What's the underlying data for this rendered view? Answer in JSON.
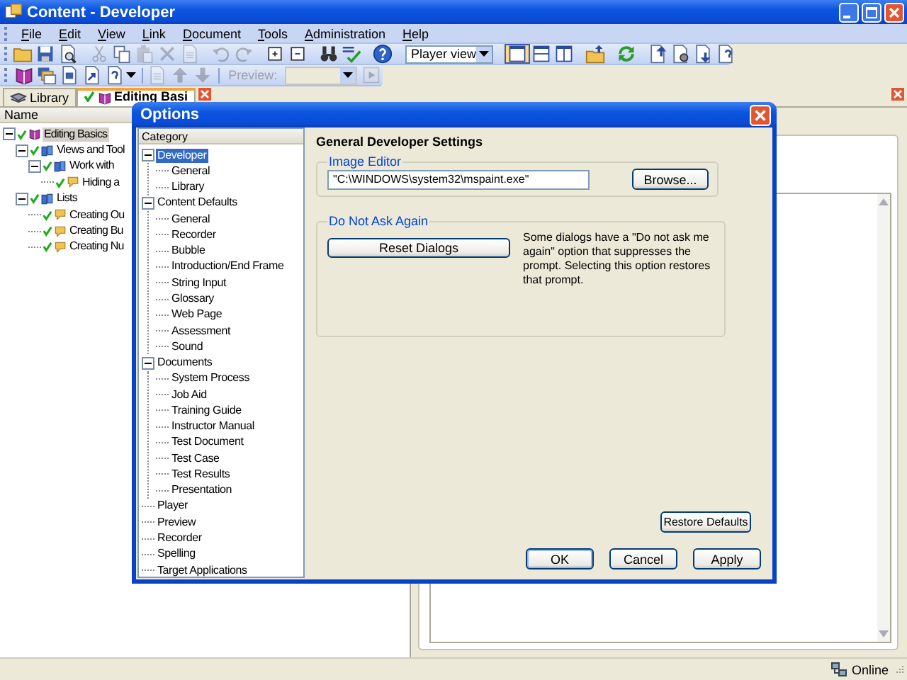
{
  "window": {
    "title": "Content - Developer"
  },
  "menu": [
    "File",
    "Edit",
    "View",
    "Link",
    "Document",
    "Tools",
    "Administration",
    "Help"
  ],
  "toolbar_1": [
    {
      "kind": "button",
      "disabled": false,
      "selected": false
    },
    {
      "kind": "button",
      "disabled": false,
      "selected": false
    },
    {
      "kind": "button",
      "disabled": false,
      "selected": false
    },
    {
      "kind": "separator"
    },
    {
      "kind": "button",
      "disabled": true,
      "selected": false
    },
    {
      "kind": "button",
      "disabled": false,
      "selected": false
    },
    {
      "kind": "button",
      "disabled": true,
      "selected": false
    },
    {
      "kind": "button",
      "disabled": true,
      "selected": false
    },
    {
      "kind": "button",
      "disabled": true,
      "selected": false
    },
    {
      "kind": "separator"
    },
    {
      "kind": "button",
      "disabled": true,
      "selected": false
    },
    {
      "kind": "button",
      "disabled": true,
      "selected": false
    },
    {
      "kind": "separator"
    },
    {
      "kind": "button",
      "disabled": false,
      "selected": false
    },
    {
      "kind": "button",
      "disabled": false,
      "selected": false
    },
    {
      "kind": "separator"
    },
    {
      "kind": "button",
      "disabled": false,
      "selected": false
    },
    {
      "kind": "button",
      "disabled": false,
      "selected": false
    },
    {
      "kind": "separator"
    },
    {
      "kind": "button",
      "disabled": false,
      "selected": false
    },
    {
      "kind": "separator"
    },
    {
      "kind": "select",
      "value": "Player view",
      "disabled": false
    },
    {
      "kind": "separator"
    },
    {
      "kind": "button",
      "disabled": false,
      "selected": true
    },
    {
      "kind": "button",
      "disabled": false,
      "selected": false
    },
    {
      "kind": "button",
      "disabled": false,
      "selected": false
    },
    {
      "kind": "separator"
    },
    {
      "kind": "button",
      "disabled": false,
      "selected": false
    },
    {
      "kind": "separator"
    },
    {
      "kind": "button",
      "disabled": false,
      "selected": false
    },
    {
      "kind": "separator"
    },
    {
      "kind": "button",
      "disabled": false,
      "selected": false
    },
    {
      "kind": "button",
      "disabled": false,
      "selected": false
    },
    {
      "kind": "button",
      "disabled": false,
      "selected": false
    },
    {
      "kind": "button",
      "disabled": false,
      "selected": false
    }
  ],
  "toolbar_2": [
    {
      "kind": "button",
      "disabled": false,
      "selected": false
    },
    {
      "kind": "button",
      "disabled": false,
      "selected": false
    },
    {
      "kind": "button",
      "disabled": false,
      "selected": false
    },
    {
      "kind": "button",
      "disabled": false,
      "selected": false
    },
    {
      "kind": "dropdown_button",
      "disabled": false,
      "selected": false
    },
    {
      "kind": "separator"
    },
    {
      "kind": "button",
      "disabled": true,
      "selected": false
    },
    {
      "kind": "button",
      "disabled": true,
      "selected": false
    },
    {
      "kind": "button",
      "disabled": true,
      "selected": false
    },
    {
      "kind": "separator"
    },
    {
      "kind": "label",
      "text": "Preview:",
      "disabled": true
    },
    {
      "kind": "select",
      "disabled": true
    },
    {
      "kind": "button",
      "disabled": true,
      "selected": false
    }
  ],
  "tabs": [
    {
      "label": "Library",
      "selected": false
    },
    {
      "label": "Editing Basi",
      "selected": true
    }
  ],
  "library": {
    "column": "Name",
    "tree": [
      {
        "label": "Editing Basics",
        "kind": "module",
        "selected": true,
        "expanded": true,
        "children": [
          {
            "label": "Views and Tool",
            "kind": "section",
            "selected": false,
            "expanded": true,
            "children": [
              {
                "label": "Work with",
                "kind": "section",
                "selected": false,
                "expanded": true,
                "children": [
                  {
                    "label": "Hiding a",
                    "kind": "topic",
                    "selected": false
                  }
                ]
              }
            ]
          },
          {
            "label": "Lists",
            "kind": "section",
            "selected": false,
            "expanded": true,
            "children": [
              {
                "label": "Creating Ou",
                "kind": "topic",
                "selected": false
              },
              {
                "label": "Creating Bu",
                "kind": "topic",
                "selected": false
              },
              {
                "label": "Creating Nu",
                "kind": "topic",
                "selected": false
              }
            ]
          }
        ]
      }
    ]
  },
  "dialog": {
    "title": "Options",
    "category_header": "Category",
    "categories": [
      {
        "label": "Developer",
        "selected": true,
        "expanded": true,
        "children": [
          {
            "label": "General",
            "selected": false
          },
          {
            "label": "Library",
            "selected": false
          }
        ]
      },
      {
        "label": "Content Defaults",
        "selected": false,
        "expanded": true,
        "children": [
          {
            "label": "General",
            "selected": false
          },
          {
            "label": "Recorder",
            "selected": false
          },
          {
            "label": "Bubble",
            "selected": false
          },
          {
            "label": "Introduction/End Frame",
            "selected": false
          },
          {
            "label": "String Input",
            "selected": false
          },
          {
            "label": "Glossary",
            "selected": false
          },
          {
            "label": "Web Page",
            "selected": false
          },
          {
            "label": "Assessment",
            "selected": false
          },
          {
            "label": "Sound",
            "selected": false
          }
        ]
      },
      {
        "label": "Documents",
        "selected": false,
        "expanded": true,
        "children": [
          {
            "label": "System Process",
            "selected": false
          },
          {
            "label": "Job Aid",
            "selected": false
          },
          {
            "label": "Training Guide",
            "selected": false
          },
          {
            "label": "Instructor Manual",
            "selected": false
          },
          {
            "label": "Test Document",
            "selected": false
          },
          {
            "label": "Test Case",
            "selected": false
          },
          {
            "label": "Test Results",
            "selected": false
          },
          {
            "label": "Presentation",
            "selected": false
          }
        ]
      },
      {
        "label": "Player",
        "selected": false
      },
      {
        "label": "Preview",
        "selected": false
      },
      {
        "label": "Recorder",
        "selected": false
      },
      {
        "label": "Spelling",
        "selected": false
      },
      {
        "label": "Target Applications",
        "selected": false
      }
    ],
    "heading": "General Developer Settings",
    "image_editor": {
      "legend": "Image Editor",
      "value": "\"C:\\WINDOWS\\system32\\mspaint.exe\"",
      "button": "Browse..."
    },
    "do_not_ask": {
      "legend": "Do Not Ask Again",
      "button": "Reset Dialogs",
      "description": "Some dialogs have a \"Do not ask me again\" option that suppresses the prompt. Selecting this option restores that prompt."
    },
    "restore_button": "Restore Defaults",
    "buttons": [
      {
        "label": "OK",
        "default": true
      },
      {
        "label": "Cancel",
        "default": false
      },
      {
        "label": "Apply",
        "default": false
      }
    ]
  },
  "status_bar": {
    "status": "Online"
  }
}
